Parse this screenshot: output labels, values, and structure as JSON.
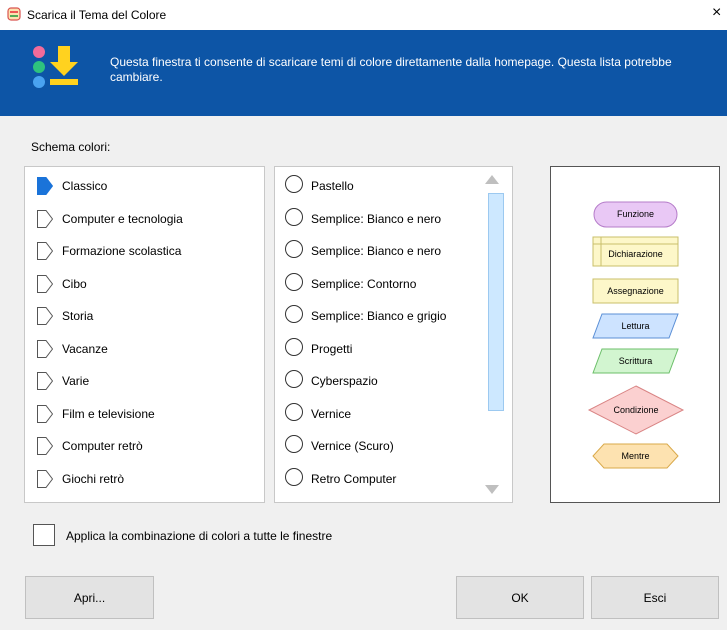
{
  "window": {
    "title": "Scarica il Tema del Colore",
    "close_glyph": "×",
    "icon": "color-theme-app-icon"
  },
  "banner": {
    "message": "Questa finestra ti consente di scaricare temi di colore direttamente dalla homepage. Questa lista potrebbe cambiare.",
    "icon": "download-theme-icon",
    "background": "#0d55a6"
  },
  "scheme_label": "Schema colori:",
  "categories": [
    {
      "label": "Classico",
      "selected": true
    },
    {
      "label": "Computer e tecnologia",
      "selected": false
    },
    {
      "label": "Formazione scolastica",
      "selected": false
    },
    {
      "label": "Cibo",
      "selected": false
    },
    {
      "label": "Storia",
      "selected": false
    },
    {
      "label": "Vacanze",
      "selected": false
    },
    {
      "label": "Varie",
      "selected": false
    },
    {
      "label": "Film e televisione",
      "selected": false
    },
    {
      "label": "Computer retrò",
      "selected": false
    },
    {
      "label": "Giochi retrò",
      "selected": false
    }
  ],
  "themes": [
    {
      "label": "Pastello",
      "selected": false
    },
    {
      "label": "Semplice: Bianco e nero",
      "selected": false
    },
    {
      "label": "Semplice: Bianco e nero",
      "selected": false
    },
    {
      "label": "Semplice: Contorno",
      "selected": false
    },
    {
      "label": "Semplice: Bianco e grigio",
      "selected": false
    },
    {
      "label": "Progetti",
      "selected": false
    },
    {
      "label": "Cyberspazio",
      "selected": false
    },
    {
      "label": "Vernice",
      "selected": false
    },
    {
      "label": "Vernice (Scuro)",
      "selected": false
    },
    {
      "label": "Retro Computer",
      "selected": false
    }
  ],
  "preview": {
    "funzione": "Funzione",
    "dichiarazione": "Dichiarazione",
    "assegnazione": "Assegnazione",
    "lettura": "Lettura",
    "scrittura": "Scrittura",
    "condizione": "Condizione",
    "mentre": "Mentre",
    "colors": {
      "funzione": "#e9c8f5",
      "dichiarazione": "#fdf7c9",
      "assegnazione": "#fdf7c9",
      "lettura": "#cde3ff",
      "scrittura": "#d2f5d0",
      "condizione": "#fbd0d0",
      "mentre": "#fde2b0"
    }
  },
  "apply_all": {
    "label": "Applica la combinazione di colori a tutte le finestre",
    "checked": false
  },
  "buttons": {
    "open": "Apri...",
    "ok": "OK",
    "exit": "Esci"
  }
}
